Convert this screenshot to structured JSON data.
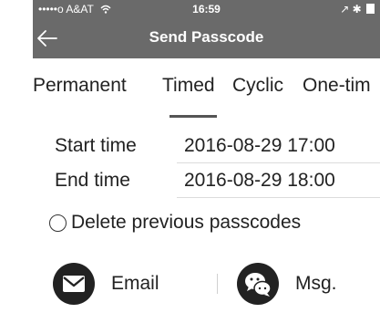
{
  "status_bar": {
    "carrier": "•••••o A&AT",
    "wifi_icon": "wifi-icon",
    "time": "16:59",
    "right_indicators": "↗ ✱"
  },
  "nav": {
    "title": "Send Passcode",
    "back_icon": "arrow-left-icon"
  },
  "tabs": [
    {
      "label": "Permanent",
      "selected": false
    },
    {
      "label": "Timed",
      "selected": true
    },
    {
      "label": "Cyclic",
      "selected": false
    },
    {
      "label": "One-tim",
      "selected": false
    }
  ],
  "form": {
    "start_label": "Start time",
    "start_value": "2016-08-29 17:00",
    "end_label": "End time",
    "end_value": "2016-08-29 18:00",
    "delete_label": "Delete previous passcodes",
    "delete_checked": false
  },
  "share": {
    "email_label": "Email",
    "email_icon": "envelope-icon",
    "msg_label": "Msg.",
    "msg_icon": "chat-bubbles-icon"
  },
  "colors": {
    "header_bg": "#6a6a6a",
    "text": "#222222",
    "icon_bg": "#222222"
  }
}
